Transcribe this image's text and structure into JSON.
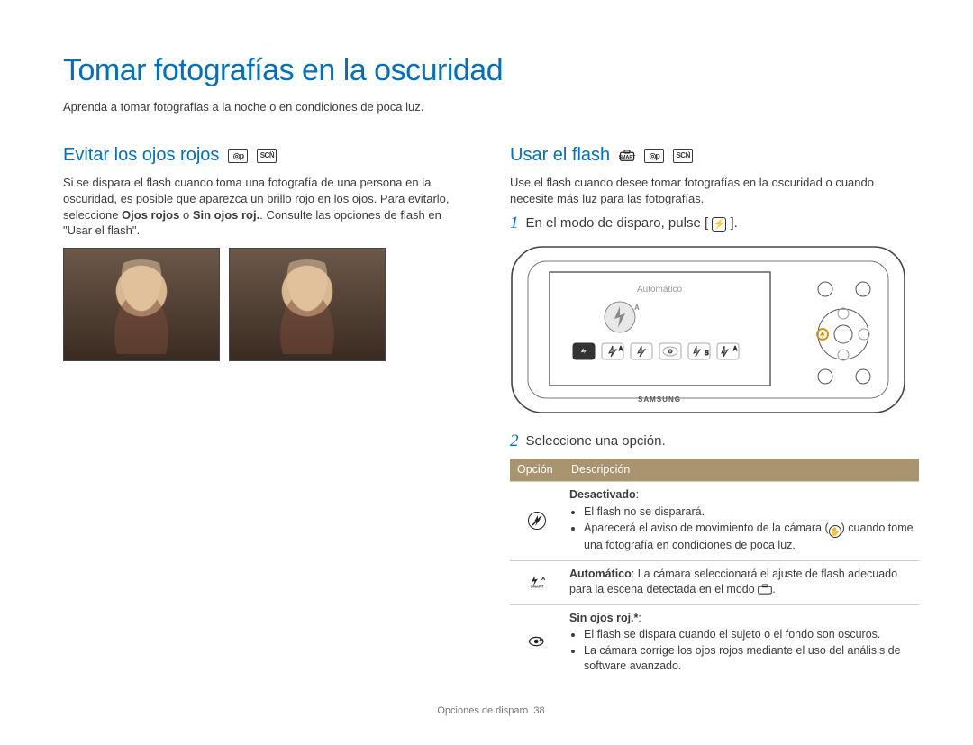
{
  "page_title": "Tomar fotografías en la oscuridad",
  "intro": "Aprenda a tomar fotografías a la noche o en condiciones de poca luz.",
  "left": {
    "heading": "Evitar los ojos rojos",
    "para_lead": "Si se dispara el flash cuando toma una fotografía de una persona en la oscuridad, es posible que aparezca un brillo rojo en los ojos. Para evitarlo, seleccione ",
    "para_bold_a": "Ojos rojos",
    "para_mid": " o ",
    "para_bold_b": "Sin ojos roj.",
    "para_trail": ". Consulte las opciones de flash en \"Usar el flash\"."
  },
  "right": {
    "heading": "Usar el flash",
    "para": "Use el flash cuando desee tomar fotografías en la oscuridad o cuando necesite más luz para las fotografías.",
    "step1_lead": "En el modo de disparo, pulse [",
    "step1_trail": "].",
    "lcd_label": "Automático",
    "camera_brand": "SAMSUNG",
    "step2": "Seleccione una opción.",
    "table": {
      "header_option": "Opción",
      "header_desc": "Descripción",
      "rows": [
        {
          "title": "Desactivado",
          "title_extra": ":",
          "bullets": [
            "El flash no se disparará.",
            "Aparecerá el aviso de movimiento de la cámara (HAND) cuando tome una fotografía en condiciones de poca luz."
          ]
        },
        {
          "inline_title": "Automático",
          "inline_body": ": La cámara seleccionará el ajuste de flash adecuado para la escena detectada en el modo (SMART)."
        },
        {
          "title": "Sin ojos roj.*",
          "title_extra": ":",
          "bullets": [
            "El flash se dispara cuando el sujeto o el fondo son oscuros.",
            "La cámara corrige los ojos rojos mediante el uso del análisis de software avanzado."
          ]
        }
      ]
    }
  },
  "footer_section": "Opciones de disparo",
  "footer_page": "38"
}
